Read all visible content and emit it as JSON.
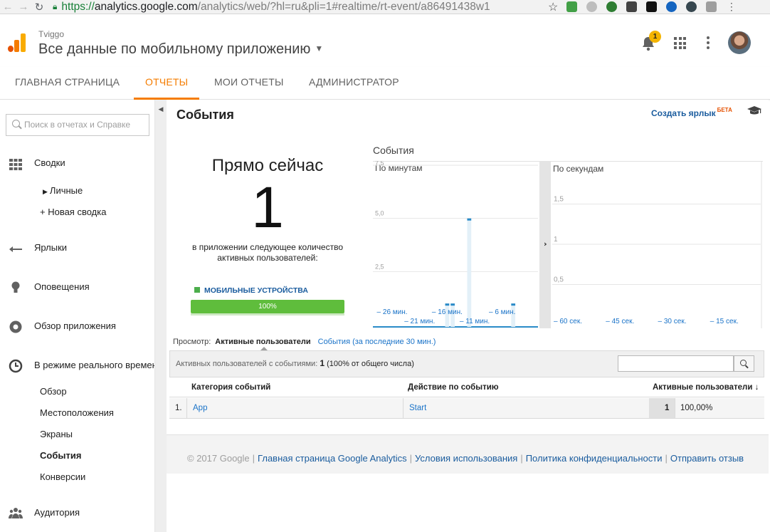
{
  "browser": {
    "url_scheme": "https://",
    "url_host": "analytics.google.com",
    "url_rest": "/analytics/web/?hl=ru&pli=1#realtime/rt-event/a86491438w1"
  },
  "header": {
    "account": "Tviggo",
    "property": "Все данные по мобильному приложению",
    "notification_count": "1"
  },
  "tabs": [
    {
      "label": "ГЛАВНАЯ СТРАНИЦА"
    },
    {
      "label": "ОТЧЕТЫ"
    },
    {
      "label": "МОИ ОТЧЕТЫ"
    },
    {
      "label": "АДМИНИСТРАТОР"
    }
  ],
  "active_tab": "ОТЧЕТЫ",
  "sidebar": {
    "search_placeholder": "Поиск в отчетах и Справке",
    "dashboards": "Сводки",
    "personal": "Личные",
    "new_dashboard": "+ Новая сводка",
    "shortcuts": "Ярлыки",
    "alerts": "Оповещения",
    "app_overview": "Обзор приложения",
    "realtime": "В режиме реального времени",
    "realtime_items": [
      "Обзор",
      "Местоположения",
      "Экраны",
      "События",
      "Конверсии"
    ],
    "active_item": "События",
    "audience": "Аудитория"
  },
  "main": {
    "title": "События",
    "create_shortcut": "Создать ярлык",
    "beta": "БЕТА",
    "now_label": "Прямо сейчас",
    "now_count": "1",
    "now_description": "в приложении следующее количество активных пользователей:",
    "device_label": "МОБИЛЬНЫЕ УСТРОЙСТВА",
    "device_percent": "100%",
    "device_fraction": 1.0
  },
  "chart_data": [
    {
      "type": "bar",
      "title": "События",
      "panel": "По минутам",
      "ylim": [
        0,
        7.5
      ],
      "y_ticks": [
        "7,5",
        "5,0",
        "2,5"
      ],
      "x_ticks": [
        "– 26 мин.",
        "– 21 мин.",
        "– 16 мин.",
        "– 11 мин.",
        "– 6 мин."
      ],
      "x_minutes_ago": [
        -29,
        -28,
        -27,
        -26,
        -25,
        -24,
        -23,
        -22,
        -21,
        -20,
        -19,
        -18,
        -17,
        -16,
        -15,
        -14,
        -13,
        -12,
        -11,
        -10,
        -9,
        -8,
        -7,
        -6,
        -5,
        -4,
        -3,
        -2,
        -1,
        0
      ],
      "values": [
        0,
        0,
        0,
        0,
        0,
        0,
        0,
        0,
        0,
        0,
        0,
        0,
        0,
        1,
        1,
        0,
        0,
        5,
        0,
        0,
        0,
        0,
        0,
        0,
        0,
        1,
        0,
        0,
        0,
        0
      ]
    },
    {
      "type": "bar",
      "panel": "По секундам",
      "ylim": [
        0,
        2
      ],
      "y_ticks": [
        "1,5",
        "1",
        "0,5"
      ],
      "x_ticks": [
        "– 60 сек.",
        "– 45 сек.",
        "– 30 сек.",
        "– 15 сек."
      ],
      "values": []
    }
  ],
  "table": {
    "view_label": "Просмотр:",
    "view_active": "Активные пользователи",
    "view_other": "События (за последние 30 мин.)",
    "summary_label": "Активных пользователей с событиями:",
    "summary_value": "1",
    "summary_pct": "(100% от общего числа)",
    "headers": [
      "Категория событий",
      "Действие по событию",
      "Активные пользователи"
    ],
    "rows": [
      {
        "index": "1.",
        "category": "App",
        "action": "Start",
        "users": "1",
        "pct": "100,00%"
      }
    ]
  },
  "footer": {
    "copyright": "© 2017 Google",
    "links": [
      "Главная страница Google Analytics",
      "Условия использования",
      "Политика конфиденциальности",
      "Отправить отзыв"
    ]
  },
  "colors": {
    "accent": "#f57c00",
    "link": "#1a73c8",
    "bar": "#2a8bc8",
    "progress": "#5fbd3c"
  }
}
